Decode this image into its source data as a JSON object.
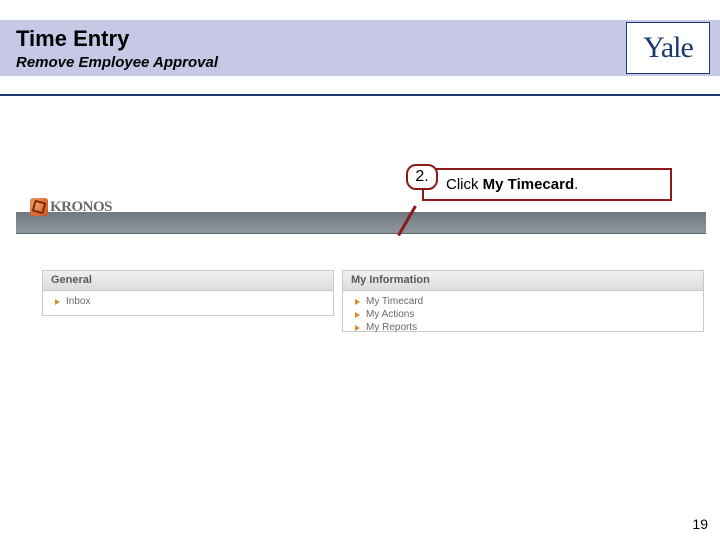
{
  "header": {
    "title": "Time Entry",
    "subtitle": "Remove Employee Approval",
    "logo_text": "Yale"
  },
  "app": {
    "brand": "KRONOS"
  },
  "callout": {
    "step": "2.",
    "prefix": "Click ",
    "bold": "My Timecard",
    "suffix": "."
  },
  "panels": {
    "general": {
      "title": "General",
      "items": [
        "Inbox"
      ]
    },
    "myinfo": {
      "title": "My Information",
      "items": [
        "My Timecard",
        "My Actions",
        "My Reports"
      ]
    }
  },
  "page_number": "19"
}
